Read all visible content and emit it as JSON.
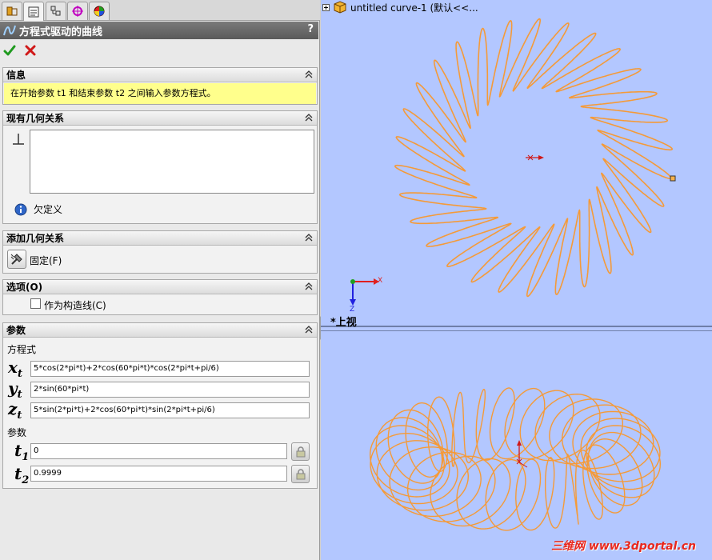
{
  "property_manager": {
    "title": "方程式驱动的曲线",
    "help": "?",
    "groups": {
      "info": {
        "header": "信息",
        "message": "在开始参数 t1 和结束参数 t2 之间输入参数方程式。"
      },
      "existing_relations": {
        "header": "现有几何关系",
        "status": "欠定义"
      },
      "add_relations": {
        "header": "添加几何关系",
        "fix_label": "固定(F)"
      },
      "options": {
        "header": "选项(O)",
        "construction_label": "作为构造线(C)",
        "construction_checked": false
      },
      "parameters": {
        "header": "参数",
        "equation_label": "方程式",
        "param_label": "参数",
        "xt": "5*cos(2*pi*t)+2*cos(60*pi*t)*cos(2*pi*t+pi/6)",
        "yt": "2*sin(60*pi*t)",
        "zt": "5*sin(2*pi*t)+2*cos(60*pi*t)*sin(2*pi*t+pi/6)",
        "t1": "0",
        "t2": "0.9999",
        "sym_x": "x",
        "sym_y": "y",
        "sym_z": "z",
        "sym_t": "t",
        "sub_t": "t",
        "sub_1": "1",
        "sub_2": "2"
      }
    }
  },
  "graphics": {
    "tree_label": "untitled curve-1  (默认<<...",
    "top_view_label": "*上视",
    "axis_x": "X",
    "axis_z": "Z",
    "watermark": "三维网 www.3dportal.cn",
    "curve_color": "#f59a38",
    "background": "#b3c7ff"
  }
}
